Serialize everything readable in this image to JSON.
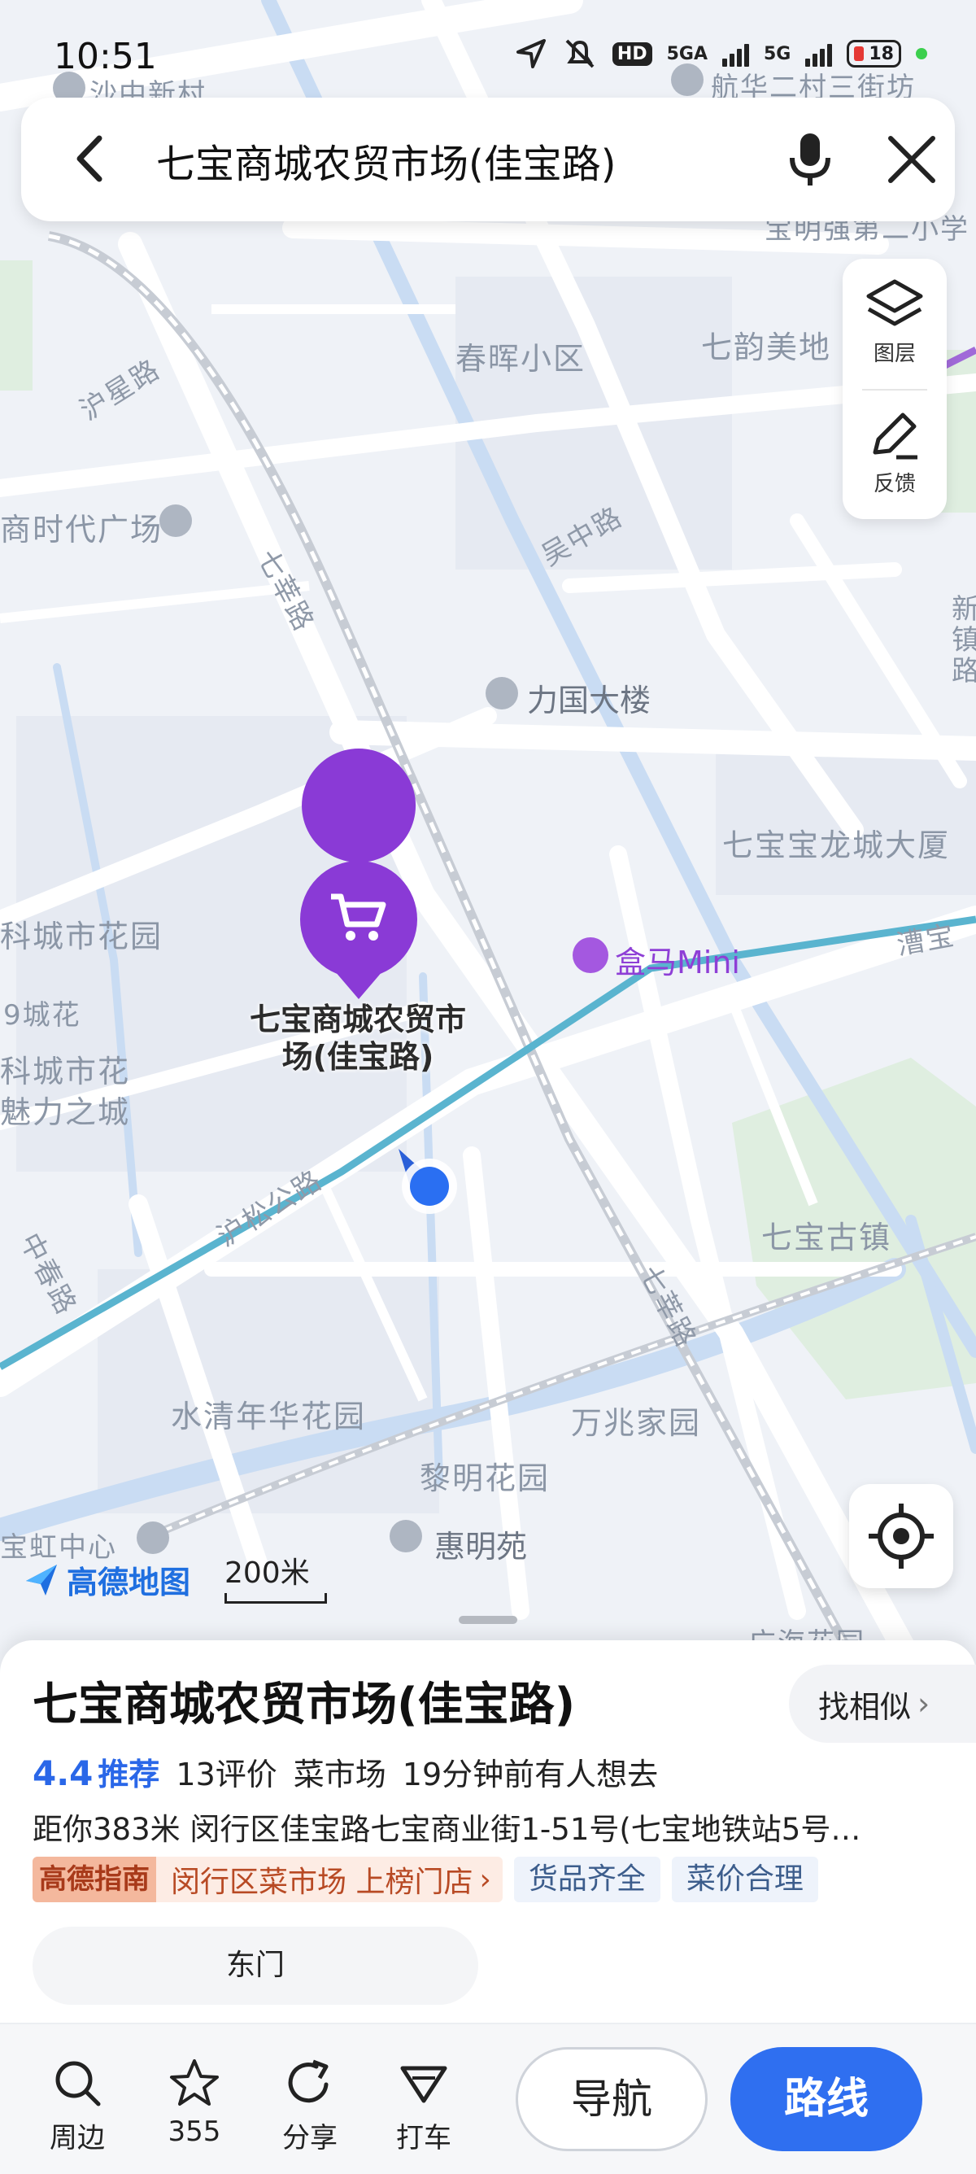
{
  "status_bar": {
    "time": "10:51",
    "hd": "HD",
    "net1": "5GA",
    "net2": "5G",
    "battery": "18"
  },
  "search": {
    "query": "七宝商城农贸市场(佳宝路)"
  },
  "tools": {
    "layers": "图层",
    "feedback": "反馈"
  },
  "map": {
    "labels": {
      "shazhong": "沙中新村",
      "hanghua": "航华二村三街坊",
      "chunhui": "春晖小区",
      "qiyun": "七韵美地",
      "huxing": "沪星路",
      "times_square": "商时代广场",
      "qixin": "七莘路",
      "wuzhong": "吴中路",
      "liguo": "力国大楼",
      "baolong": "七宝宝龙城大厦",
      "xinzhen": "新镇路",
      "kecheng": "科城市花园",
      "city9": "9城花",
      "kecheng2": "科城市花",
      "meili": "魅力之城",
      "hema": "盒马Mini",
      "caobao": "漕宝",
      "husong": "沪松公路",
      "zhongchun": "中春路",
      "qibao_town": "七宝古镇",
      "qixin2": "七莘路",
      "shuiqing": "水清年华花园",
      "wanzhao": "万兆家园",
      "liming": "黎明花园",
      "huiming": "惠明苑",
      "baohong": "宝虹中心",
      "guanghai": "广海花园",
      "zhongmiao": "宝明强第二小学"
    },
    "pin_label": "七宝商城农贸市场(佳宝路)",
    "logo": "高德地图",
    "scale": "200米"
  },
  "place": {
    "title": "七宝商城农贸市场(佳宝路)",
    "similar": "找相似",
    "rating": "4.4",
    "recommend": "推荐",
    "reviews": "13评价",
    "category": "菜市场",
    "interest": "19分钟前有人想去",
    "address": "距你383米  闵行区佳宝路七宝商业街1-51号(七宝地铁站5号…",
    "guide_logo": "高德指南",
    "guide_text": "闵行区菜市场 上榜门店",
    "tags": [
      "货品齐全",
      "菜价合理"
    ],
    "entrance": "东门"
  },
  "bottom": {
    "nearby": "周边",
    "favorites": "355",
    "share": "分享",
    "taxi": "打车",
    "navigate": "导航",
    "route": "路线"
  },
  "colors": {
    "accent": "#2f6ff0",
    "route_line": "#5ab4cf",
    "pin": "#8a3ad6"
  }
}
